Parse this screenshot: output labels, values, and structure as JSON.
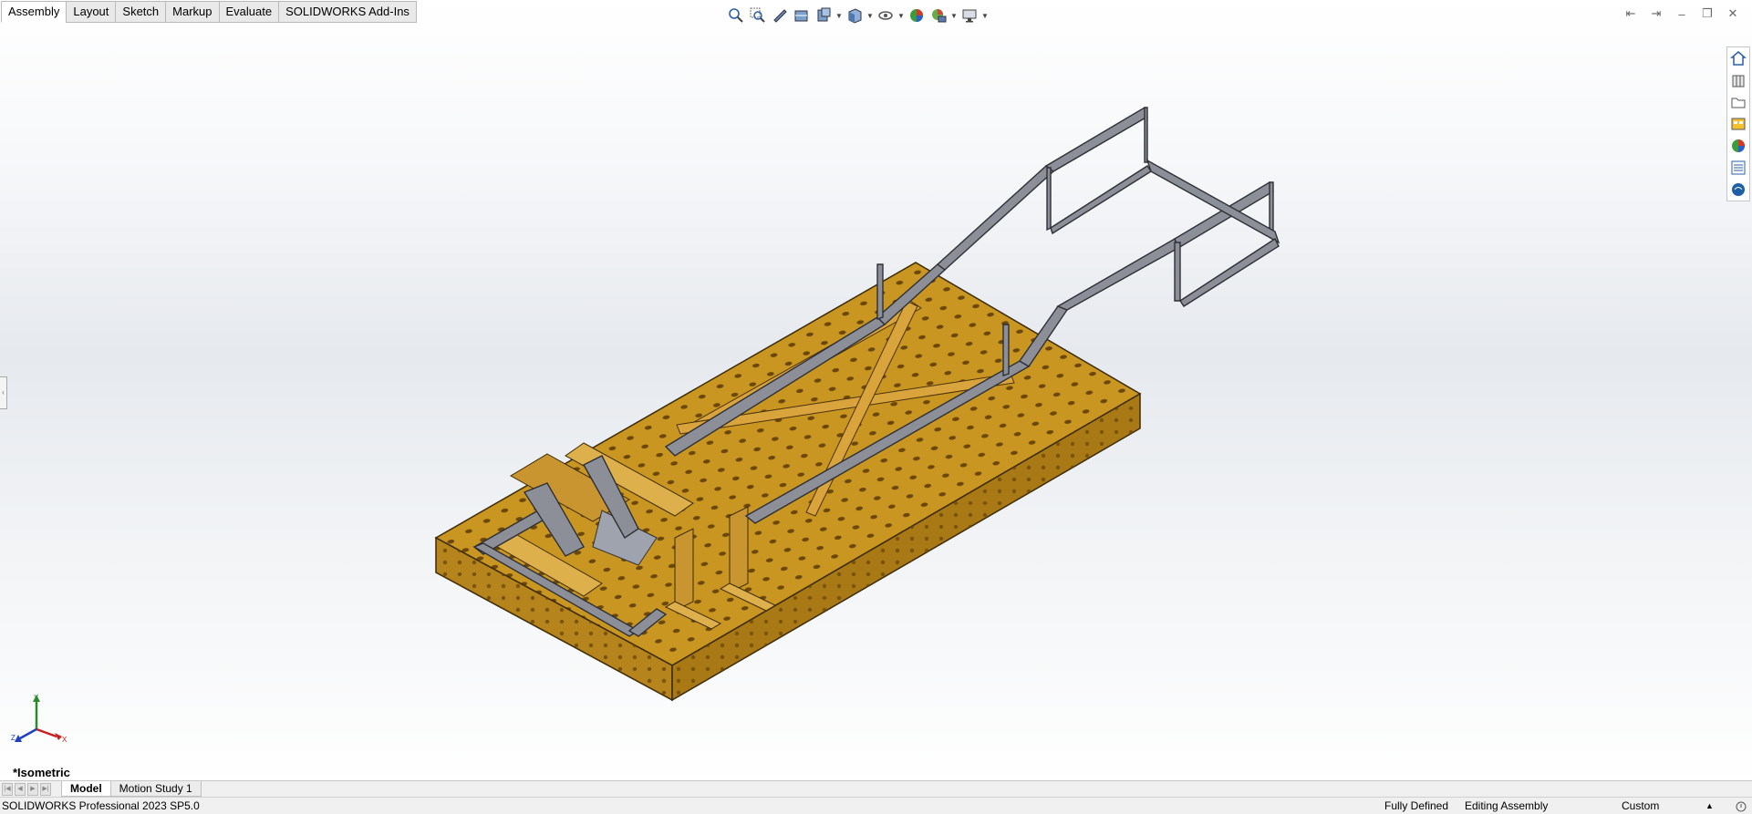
{
  "command_manager": {
    "tabs": [
      {
        "label": "Assembly",
        "active": true
      },
      {
        "label": "Layout",
        "active": false
      },
      {
        "label": "Sketch",
        "active": false
      },
      {
        "label": "Markup",
        "active": false
      },
      {
        "label": "Evaluate",
        "active": false
      },
      {
        "label": "SOLIDWORKS Add-Ins",
        "active": false
      }
    ]
  },
  "heads_up_toolbar": {
    "icons": [
      "zoom-to-fit-icon",
      "zoom-to-area-icon",
      "previous-view-icon",
      "section-view-icon",
      "dynamic-annotation-icon",
      "view-orientation-icon",
      "display-style-icon",
      "hide-show-items-icon",
      "edit-appearance-icon",
      "apply-scene-icon",
      "view-settings-icon"
    ]
  },
  "window_controls": {
    "icons": [
      "tile-left-icon",
      "tile-right-icon",
      "minimize-icon",
      "restore-icon",
      "close-icon"
    ]
  },
  "task_pane": {
    "icons": [
      "solidworks-resources-icon",
      "design-library-icon",
      "file-explorer-icon",
      "view-palette-icon",
      "appearances-icon",
      "custom-properties-icon",
      "solidworks-forum-icon"
    ]
  },
  "graphics_area": {
    "view_name": "*Isometric",
    "triad": {
      "y": "Y",
      "x": "X",
      "z": "Z"
    },
    "model": {
      "table_color": "#c8901e",
      "frame_color": "#8c8f98"
    }
  },
  "bottom_tabs": [
    {
      "label": "Model",
      "active": true
    },
    {
      "label": "Motion Study 1",
      "active": false
    }
  ],
  "status_bar": {
    "product": "SOLIDWORKS Professional 2023 SP5.0",
    "sketch_status": "Fully Defined",
    "mode": "Editing Assembly",
    "units": "Custom"
  }
}
